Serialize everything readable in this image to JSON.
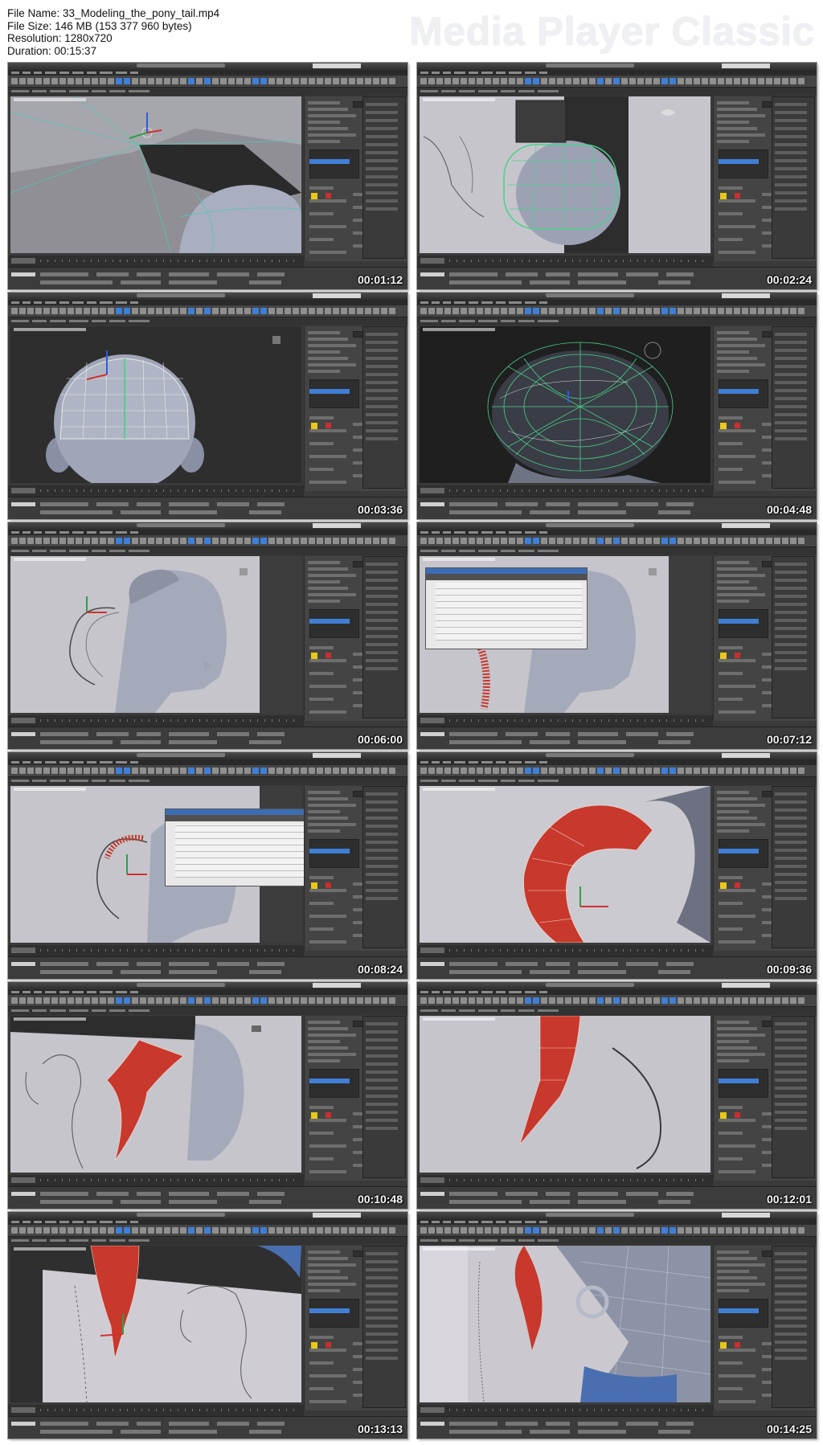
{
  "header": {
    "file_name": "File Name: 33_Modeling_the_pony_tail.mp4",
    "file_size": "File Size: 146 MB (153 377 960 bytes)",
    "resolution": "Resolution: 1280x720",
    "duration": "Duration: 00:15:37",
    "brand": "Media Player Classic"
  },
  "thumbnails": [
    {
      "timestamp": "00:01:12",
      "scene": "closeup-mesh"
    },
    {
      "timestamp": "00:02:24",
      "scene": "head-green-cage"
    },
    {
      "timestamp": "00:03:36",
      "scene": "head-back-wire"
    },
    {
      "timestamp": "00:04:48",
      "scene": "head-dark-wire"
    },
    {
      "timestamp": "00:06:00",
      "scene": "head-profile-ponytail"
    },
    {
      "timestamp": "00:07:12",
      "scene": "head-profile-dialog"
    },
    {
      "timestamp": "00:08:24",
      "scene": "ponytail-dialog"
    },
    {
      "timestamp": "00:09:36",
      "scene": "red-ponytail-large"
    },
    {
      "timestamp": "00:10:48",
      "scene": "red-ponytail-sketch"
    },
    {
      "timestamp": "00:12:01",
      "scene": "red-spike"
    },
    {
      "timestamp": "00:13:13",
      "scene": "red-spike-sketch"
    },
    {
      "timestamp": "00:14:25",
      "scene": "red-spike-ear"
    }
  ],
  "colors": {
    "viewport_light": "#c3c2c9",
    "model_gray": "#9ea3b3",
    "wire_green": "#46d08a",
    "hair_red": "#c8382c",
    "ui_dark": "#3a3a3a",
    "selection_blue": "#3f7fd6"
  }
}
